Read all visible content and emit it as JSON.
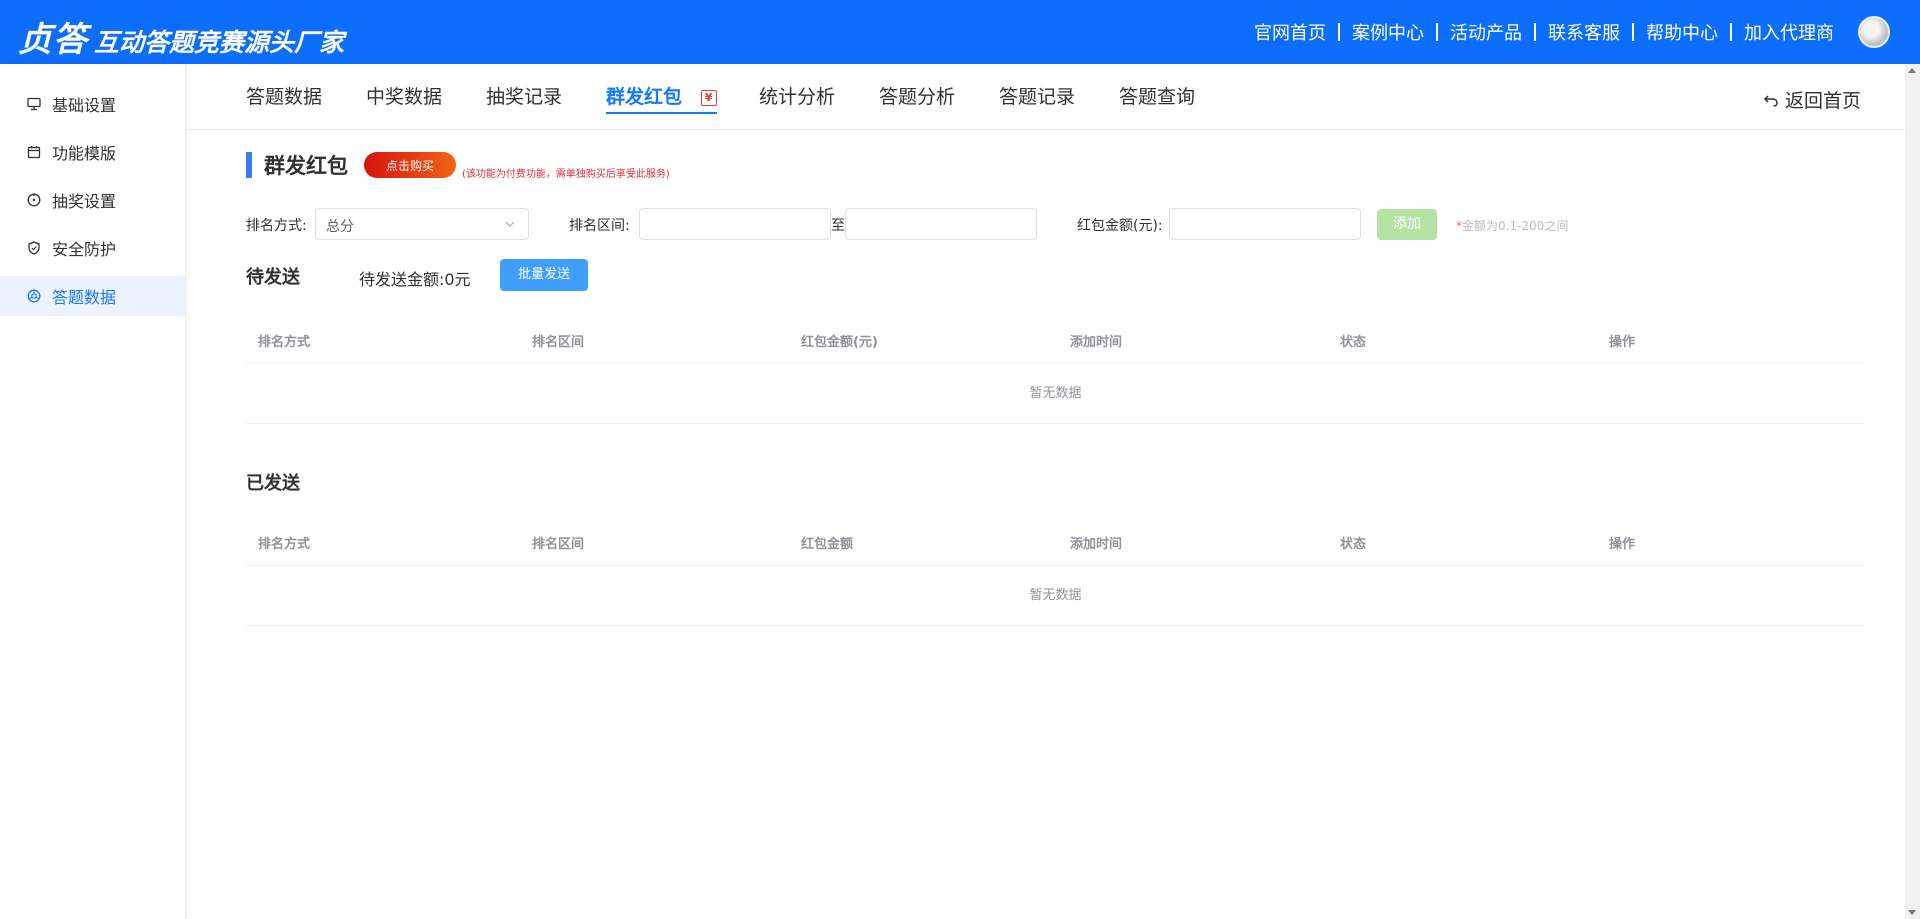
{
  "header": {
    "brand_main": "贞答",
    "brand_sub": "互动答题竞赛源头厂家",
    "nav": [
      "官网首页",
      "案例中心",
      "活动产品",
      "联系客服",
      "帮助中心",
      "加入代理商"
    ]
  },
  "sidebar": {
    "items": [
      {
        "label": "基础设置",
        "icon": "monitor-icon"
      },
      {
        "label": "功能模版",
        "icon": "calendar-icon"
      },
      {
        "label": "抽奖设置",
        "icon": "compass-icon"
      },
      {
        "label": "安全防护",
        "icon": "shield-icon"
      },
      {
        "label": "答题数据",
        "icon": "aperture-icon",
        "active": true
      }
    ]
  },
  "tabs": {
    "items": [
      "答题数据",
      "中奖数据",
      "抽奖记录",
      "群发红包",
      "统计分析",
      "答题分析",
      "答题记录",
      "答题查询"
    ],
    "active": "群发红包",
    "yen_badge": "¥",
    "back_label": "返回首页"
  },
  "section": {
    "title": "群发红包",
    "buy_label": "点击购买",
    "paid_note": "(该功能为付费功能，需单独购买后享受此服务)"
  },
  "filters": {
    "rank_method_label": "排名方式:",
    "rank_method_value": "总分",
    "rank_range_label": "排名区间:",
    "range_sep": "至",
    "amount_label": "红包金额(元):",
    "add_label": "添加",
    "hint_star": "*",
    "hint_text": "金额为0.1-200之间"
  },
  "pending": {
    "title": "待发送",
    "amount_label": "待发送金额:",
    "amount_value": "0元",
    "batch_label": "批量发送",
    "columns": [
      "排名方式",
      "排名区间",
      "红包金额(元)",
      "添加时间",
      "状态",
      "操作"
    ],
    "empty": "暂无数据"
  },
  "sent": {
    "title": "已发送",
    "columns": [
      "排名方式",
      "排名区间",
      "红包金额",
      "添加时间",
      "状态",
      "操作"
    ],
    "empty": "暂无数据"
  }
}
